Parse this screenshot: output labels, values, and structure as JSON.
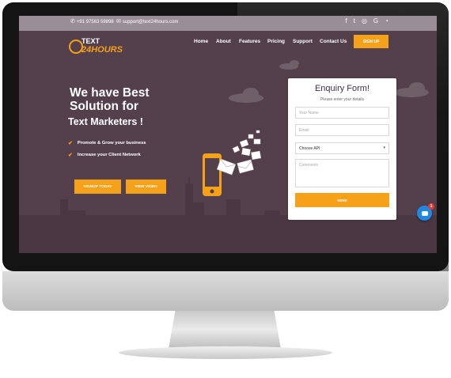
{
  "topbar": {
    "phone": "+91 97563 59898",
    "email": "support@text24hours.com",
    "social_icons": [
      "facebook-icon",
      "twitter-icon",
      "instagram-icon",
      "google-plus-icon",
      "rss-icon"
    ]
  },
  "header": {
    "logo_top": "TEXT",
    "logo_bottom": "24HOURS",
    "nav": [
      "Home",
      "About",
      "Features",
      "Pricing",
      "Support",
      "Contact Us"
    ],
    "signup_label": "SIGN UP"
  },
  "hero": {
    "line1": "We have Best",
    "line2": "Solution for",
    "line3": "Text Marketers !",
    "features": [
      "Promote & Grow your business",
      "Increase your Client Network"
    ],
    "signup_today": "SIGNUP TODAY",
    "view_video": "VIEW VIDEO"
  },
  "form": {
    "title": "Enquiry Form!",
    "subtitle": "Please enter your details",
    "name_placeholder": "Your Name",
    "email_placeholder": "Email",
    "select_value": "Choose API",
    "comments_placeholder": "Comments",
    "send_label": "SEND"
  },
  "chat": {
    "badge": "1"
  },
  "colors": {
    "accent": "#f5a11a",
    "background": "#54404b",
    "topbar": "#9a8e96",
    "chat": "#1e88e5"
  }
}
